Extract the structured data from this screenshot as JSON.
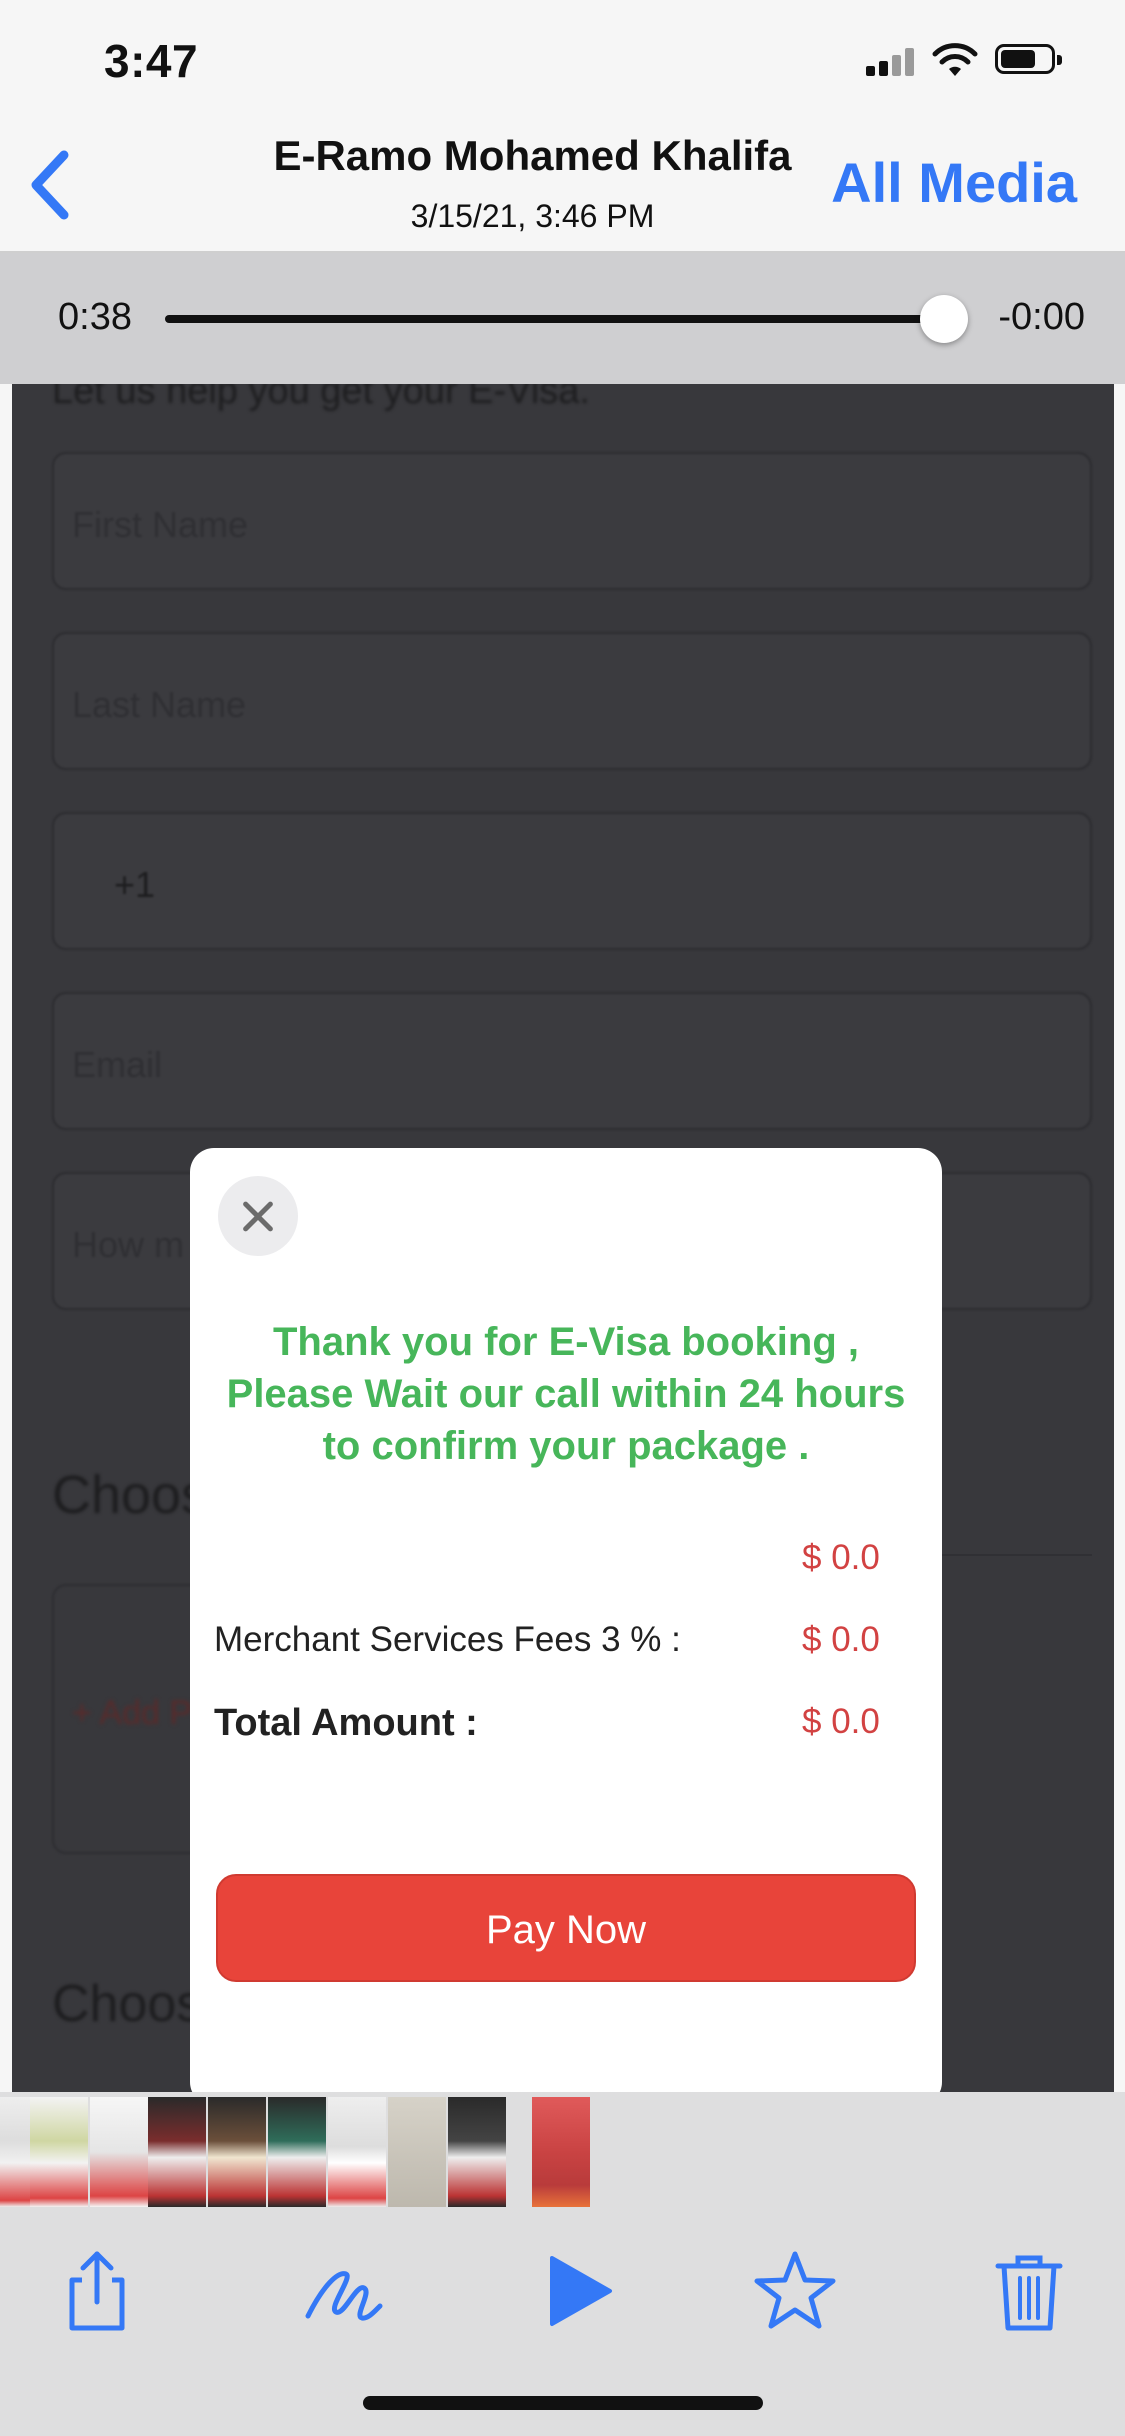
{
  "status_bar": {
    "time": "3:47"
  },
  "nav": {
    "title": "E-Ramo Mohamed Khalifa",
    "subtitle": "3/15/21, 3:46 PM",
    "right_label": "All Media"
  },
  "scrubber": {
    "elapsed": "0:38",
    "remaining": "-0:00",
    "progress": 1.0
  },
  "background_form": {
    "heading": "Let us help you get your E-Visa.",
    "first_name_placeholder": "First Name",
    "last_name_placeholder": "Last Name",
    "phone_prefix": "+1",
    "email_placeholder": "Email",
    "how_many_placeholder": "How m",
    "choose_heading": "Choos",
    "add_photos": "+ Add Photos",
    "personal_images_heading": "Choose Personal Images"
  },
  "modal": {
    "message": "Thank you for E-Visa booking , Please Wait our call within 24 hours to confirm your package .",
    "rows": [
      {
        "label": "",
        "value": "$ 0.0"
      },
      {
        "label": "Merchant Services Fees 3 % :",
        "value": "$ 0.0"
      },
      {
        "label": "Total Amount :",
        "value": "$ 0.0"
      }
    ],
    "pay_button": "Pay Now"
  },
  "toolbar": {
    "icons": [
      "share-icon",
      "markup-icon",
      "play-icon",
      "favorite-star-icon",
      "trash-icon"
    ]
  },
  "colors": {
    "accent": "#3478f6",
    "success_text": "#47b65a",
    "amount_text": "#d24242",
    "pay_button": "#e8443a"
  }
}
